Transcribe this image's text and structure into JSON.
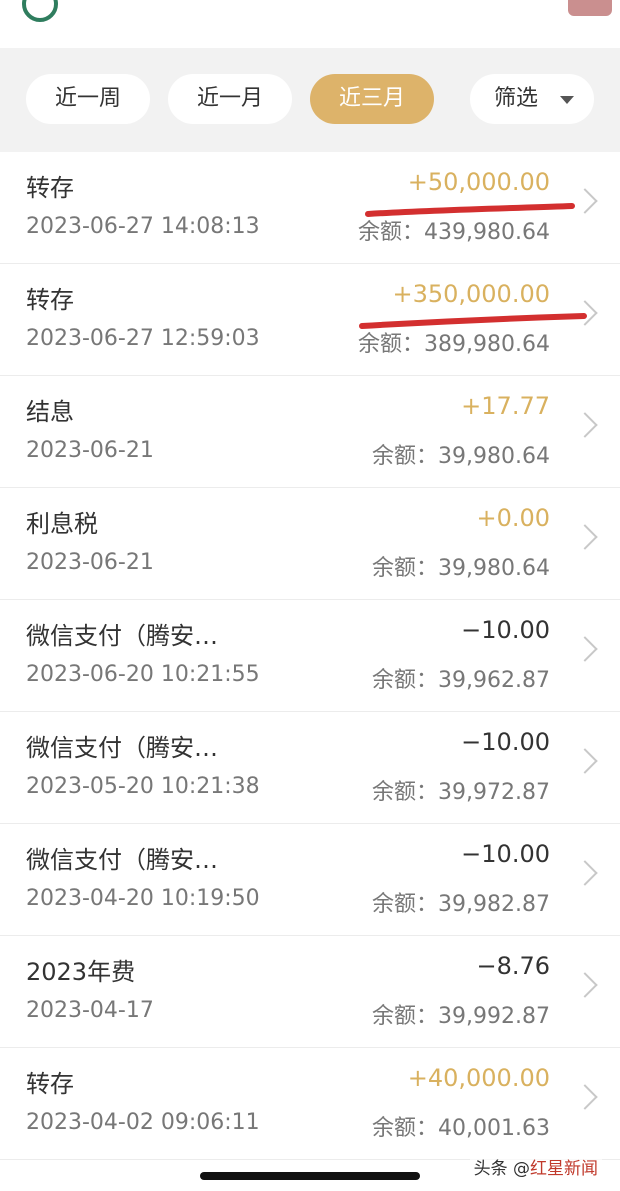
{
  "filters": {
    "tabs": [
      "近一周",
      "近一月",
      "近三月"
    ],
    "active_tab": "近三月",
    "dropdown_label": "筛选"
  },
  "balance_prefix": "余额：",
  "transactions": [
    {
      "title": "转存",
      "date": "2023-06-27 14:08:13",
      "amount": "+50,000.00",
      "balance": "439,980.64",
      "sign": "pos"
    },
    {
      "title": "转存",
      "date": "2023-06-27 12:59:03",
      "amount": "+350,000.00",
      "balance": "389,980.64",
      "sign": "pos"
    },
    {
      "title": "结息",
      "date": "2023-06-21",
      "amount": "+17.77",
      "balance": "39,980.64",
      "sign": "pos"
    },
    {
      "title": "利息税",
      "date": "2023-06-21",
      "amount": "+0.00",
      "balance": "39,980.64",
      "sign": "pos"
    },
    {
      "title": "微信支付（腾安…",
      "date": "2023-06-20 10:21:55",
      "amount": "−10.00",
      "balance": "39,962.87",
      "sign": "neg"
    },
    {
      "title": "微信支付（腾安…",
      "date": "2023-05-20 10:21:38",
      "amount": "−10.00",
      "balance": "39,972.87",
      "sign": "neg"
    },
    {
      "title": "微信支付（腾安…",
      "date": "2023-04-20 10:19:50",
      "amount": "−10.00",
      "balance": "39,982.87",
      "sign": "neg"
    },
    {
      "title": "2023年费",
      "date": "2023-04-17",
      "amount": "−8.76",
      "balance": "39,992.87",
      "sign": "neg"
    },
    {
      "title": "转存",
      "date": "2023-04-02 09:06:11",
      "amount": "+40,000.00",
      "balance": "40,001.63",
      "sign": "pos"
    }
  ],
  "colors": {
    "positive_amount": "#d9b15f",
    "active_tab_bg": "#ddb36a",
    "annotation_red": "#d32f2f"
  },
  "watermark": {
    "prefix": "头条 @",
    "source": "红星新闻"
  }
}
